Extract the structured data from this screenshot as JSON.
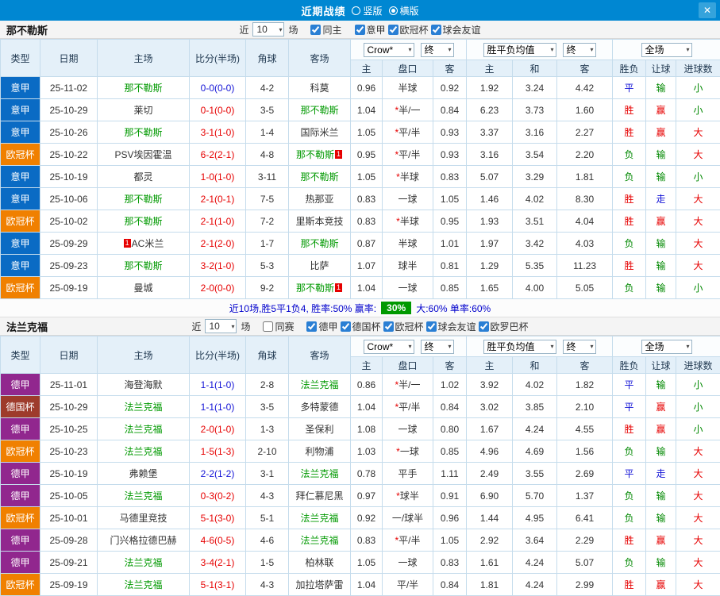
{
  "titlebar": {
    "title": "近期战绩",
    "layout_vertical": "竖版",
    "layout_horizontal": "横版",
    "selected_layout": "横版",
    "close_label": "✕"
  },
  "colors": {
    "titlebar_bg": "#0087d2",
    "focus_team": "#009900",
    "score_red": "#e60000",
    "score_blue": "#1313d6",
    "star_red": "#e60000",
    "summary_text": "#0000cc",
    "summary_badge_bg": "#009900",
    "header_cell_bg": "#e4f0f9",
    "league": {
      "意甲": "#0a6bc4",
      "欧冠杯": "#f08000",
      "德甲": "#91278e",
      "德国杯": "#9e3b2b"
    },
    "result_map": {
      "胜": "#e60000",
      "平": "#1313d6",
      "负": "#008800",
      "赢": "#e60000",
      "走": "#1313d6",
      "输": "#008800",
      "大": "#e60000",
      "小": "#008800"
    }
  },
  "table_header": {
    "left_columns": [
      "类型",
      "日期",
      "主场",
      "比分(半场)",
      "角球",
      "客场"
    ],
    "sub_columns": [
      "主",
      "盘口",
      "客",
      "主",
      "和",
      "客",
      "胜负",
      "让球",
      "进球数"
    ],
    "filter_selects": {
      "odds_source": "Crow*",
      "odds_state": "终",
      "euro_type": "胜平负均值",
      "euro_state": "终",
      "scope": "全场"
    }
  },
  "sections": [
    {
      "team": "那不勒斯",
      "near_label": "近",
      "games_count": "10",
      "games_label": "场",
      "checkboxes": [
        {
          "label": "同主",
          "checked": true
        },
        {
          "label": "意甲",
          "checked": true
        },
        {
          "label": "欧冠杯",
          "checked": true
        },
        {
          "label": "球会友谊",
          "checked": true
        }
      ],
      "rows": [
        {
          "lg": "意甲",
          "dt": "25-11-02",
          "hm": "那不勒斯",
          "sc": "0-0(0-0)",
          "scc": "blue",
          "cn": "4-2",
          "aw": "科莫",
          "h": "0.96",
          "hc": "半球",
          "a": "0.92",
          "e1": "1.92",
          "e2": "3.24",
          "e3": "4.42",
          "r1": "平",
          "r2": "输",
          "r3": "小"
        },
        {
          "lg": "意甲",
          "dt": "25-10-29",
          "hm": "莱切",
          "sc": "0-1(0-0)",
          "cn": "3-5",
          "aw": "那不勒斯",
          "h": "1.04",
          "hc": "*半/一",
          "a": "0.84",
          "e1": "6.23",
          "e2": "3.73",
          "e3": "1.60",
          "r1": "胜",
          "r2": "赢",
          "r3": "小"
        },
        {
          "lg": "意甲",
          "dt": "25-10-26",
          "hm": "那不勒斯",
          "sc": "3-1(1-0)",
          "cn": "1-4",
          "aw": "国际米兰",
          "h": "1.05",
          "hc": "*平/半",
          "a": "0.93",
          "e1": "3.37",
          "e2": "3.16",
          "e3": "2.27",
          "r1": "胜",
          "r2": "赢",
          "r3": "大"
        },
        {
          "lg": "欧冠杯",
          "dt": "25-10-22",
          "hm": "PSV埃因霍温",
          "sc": "6-2(2-1)",
          "cn": "4-8",
          "aw": "那不勒斯",
          "aw_card": "1",
          "h": "0.95",
          "hc": "*平/半",
          "a": "0.93",
          "e1": "3.16",
          "e2": "3.54",
          "e3": "2.20",
          "r1": "负",
          "r2": "输",
          "r3": "大"
        },
        {
          "lg": "意甲",
          "dt": "25-10-19",
          "hm": "都灵",
          "sc": "1-0(1-0)",
          "cn": "3-11",
          "aw": "那不勒斯",
          "h": "1.05",
          "hc": "*半球",
          "a": "0.83",
          "e1": "5.07",
          "e2": "3.29",
          "e3": "1.81",
          "r1": "负",
          "r2": "输",
          "r3": "小"
        },
        {
          "lg": "意甲",
          "dt": "25-10-06",
          "hm": "那不勒斯",
          "sc": "2-1(0-1)",
          "cn": "7-5",
          "aw": "热那亚",
          "h": "0.83",
          "hc": "一球",
          "a": "1.05",
          "e1": "1.46",
          "e2": "4.02",
          "e3": "8.30",
          "r1": "胜",
          "r2": "走",
          "r3": "大"
        },
        {
          "lg": "欧冠杯",
          "dt": "25-10-02",
          "hm": "那不勒斯",
          "sc": "2-1(1-0)",
          "cn": "7-2",
          "aw": "里斯本竞技",
          "h": "0.83",
          "hc": "*半球",
          "a": "0.95",
          "e1": "1.93",
          "e2": "3.51",
          "e3": "4.04",
          "r1": "胜",
          "r2": "赢",
          "r3": "大"
        },
        {
          "lg": "意甲",
          "dt": "25-09-29",
          "hm": "AC米兰",
          "hm_card": "1",
          "hm_card_pos": "before",
          "sc": "2-1(2-0)",
          "cn": "1-7",
          "aw": "那不勒斯",
          "h": "0.87",
          "hc": "半球",
          "a": "1.01",
          "e1": "1.97",
          "e2": "3.42",
          "e3": "4.03",
          "r1": "负",
          "r2": "输",
          "r3": "大"
        },
        {
          "lg": "意甲",
          "dt": "25-09-23",
          "hm": "那不勒斯",
          "sc": "3-2(1-0)",
          "cn": "5-3",
          "aw": "比萨",
          "h": "1.07",
          "hc": "球半",
          "a": "0.81",
          "e1": "1.29",
          "e2": "5.35",
          "e3": "11.23",
          "r1": "胜",
          "r2": "输",
          "r3": "大"
        },
        {
          "lg": "欧冠杯",
          "dt": "25-09-19",
          "hm": "曼城",
          "sc": "2-0(0-0)",
          "cn": "9-2",
          "aw": "那不勒斯",
          "aw_card": "1",
          "h": "1.04",
          "hc": "一球",
          "a": "0.85",
          "e1": "1.65",
          "e2": "4.00",
          "e3": "5.05",
          "r1": "负",
          "r2": "输",
          "r3": "小"
        }
      ],
      "summary": {
        "prefix": "近10场,胜5平1负4, 胜率:50% 赢率:",
        "badge": "30%",
        "suffix": "大:60% 单率:60%"
      }
    },
    {
      "team": "法兰克福",
      "near_label": "近",
      "games_count": "10",
      "games_label": "场",
      "checkboxes": [
        {
          "label": "同赛",
          "checked": false
        },
        {
          "label": "德甲",
          "checked": true
        },
        {
          "label": "德国杯",
          "checked": true
        },
        {
          "label": "欧冠杯",
          "checked": true
        },
        {
          "label": "球会友谊",
          "checked": true
        },
        {
          "label": "欧罗巴杯",
          "checked": true
        }
      ],
      "rows": [
        {
          "lg": "德甲",
          "dt": "25-11-01",
          "hm": "海登海默",
          "sc": "1-1(1-0)",
          "scc": "blue",
          "cn": "2-8",
          "aw": "法兰克福",
          "h": "0.86",
          "hc": "*半/一",
          "a": "1.02",
          "e1": "3.92",
          "e2": "4.02",
          "e3": "1.82",
          "r1": "平",
          "r2": "输",
          "r3": "小"
        },
        {
          "lg": "德国杯",
          "dt": "25-10-29",
          "hm": "法兰克福",
          "sc": "1-1(1-0)",
          "scc": "blue",
          "cn": "3-5",
          "aw": "多特蒙德",
          "h": "1.04",
          "hc": "*平/半",
          "a": "0.84",
          "e1": "3.02",
          "e2": "3.85",
          "e3": "2.10",
          "r1": "平",
          "r2": "赢",
          "r3": "小"
        },
        {
          "lg": "德甲",
          "dt": "25-10-25",
          "hm": "法兰克福",
          "sc": "2-0(1-0)",
          "cn": "1-3",
          "aw": "圣保利",
          "h": "1.08",
          "hc": "一球",
          "a": "0.80",
          "e1": "1.67",
          "e2": "4.24",
          "e3": "4.55",
          "r1": "胜",
          "r2": "赢",
          "r3": "小"
        },
        {
          "lg": "欧冠杯",
          "dt": "25-10-23",
          "hm": "法兰克福",
          "sc": "1-5(1-3)",
          "cn": "2-10",
          "aw": "利物浦",
          "h": "1.03",
          "hc": "*一球",
          "a": "0.85",
          "e1": "4.96",
          "e2": "4.69",
          "e3": "1.56",
          "r1": "负",
          "r2": "输",
          "r3": "大"
        },
        {
          "lg": "德甲",
          "dt": "25-10-19",
          "hm": "弗赖堡",
          "sc": "2-2(1-2)",
          "scc": "blue",
          "cn": "3-1",
          "aw": "法兰克福",
          "h": "0.78",
          "hc": "平手",
          "a": "1.11",
          "e1": "2.49",
          "e2": "3.55",
          "e3": "2.69",
          "r1": "平",
          "r2": "走",
          "r3": "大"
        },
        {
          "lg": "德甲",
          "dt": "25-10-05",
          "hm": "法兰克福",
          "sc": "0-3(0-2)",
          "cn": "4-3",
          "aw": "拜仁慕尼黑",
          "h": "0.97",
          "hc": "*球半",
          "a": "0.91",
          "e1": "6.90",
          "e2": "5.70",
          "e3": "1.37",
          "r1": "负",
          "r2": "输",
          "r3": "大"
        },
        {
          "lg": "欧冠杯",
          "dt": "25-10-01",
          "hm": "马德里竞技",
          "sc": "5-1(3-0)",
          "cn": "5-1",
          "aw": "法兰克福",
          "h": "0.92",
          "hc": "一/球半",
          "a": "0.96",
          "e1": "1.44",
          "e2": "4.95",
          "e3": "6.41",
          "r1": "负",
          "r2": "输",
          "r3": "大"
        },
        {
          "lg": "德甲",
          "dt": "25-09-28",
          "hm": "门兴格拉德巴赫",
          "sc": "4-6(0-5)",
          "cn": "4-6",
          "aw": "法兰克福",
          "h": "0.83",
          "hc": "*平/半",
          "a": "1.05",
          "e1": "2.92",
          "e2": "3.64",
          "e3": "2.29",
          "r1": "胜",
          "r2": "赢",
          "r3": "大"
        },
        {
          "lg": "德甲",
          "dt": "25-09-21",
          "hm": "法兰克福",
          "sc": "3-4(2-1)",
          "cn": "1-5",
          "aw": "柏林联",
          "h": "1.05",
          "hc": "一球",
          "a": "0.83",
          "e1": "1.61",
          "e2": "4.24",
          "e3": "5.07",
          "r1": "负",
          "r2": "输",
          "r3": "大"
        },
        {
          "lg": "欧冠杯",
          "dt": "25-09-19",
          "hm": "法兰克福",
          "sc": "5-1(3-1)",
          "cn": "4-3",
          "aw": "加拉塔萨雷",
          "h": "1.04",
          "hc": "平/半",
          "a": "0.84",
          "e1": "1.81",
          "e2": "4.24",
          "e3": "2.99",
          "r1": "胜",
          "r2": "赢",
          "r3": "大"
        }
      ]
    }
  ]
}
